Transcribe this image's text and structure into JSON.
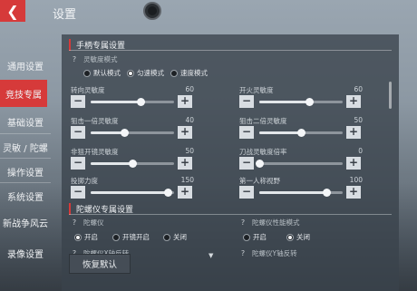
{
  "header": {
    "title": "设置",
    "back_icon": "chevron-left-icon"
  },
  "sidebar": {
    "items": [
      {
        "label": "通用设置",
        "active": false
      },
      {
        "label": "竞技专属",
        "active": true
      },
      {
        "label": "基础设置",
        "active": false
      },
      {
        "label": "灵敏 / 陀螺",
        "active": false
      },
      {
        "label": "操作设置",
        "active": false
      },
      {
        "label": "系统设置",
        "active": false
      },
      {
        "label": "新战争风云",
        "active": false
      },
      {
        "label": "录像设置",
        "active": false
      }
    ]
  },
  "section1": {
    "title": "手柄专属设置",
    "mode": {
      "label": "灵敏度模式",
      "options": [
        "默认模式",
        "匀速模式",
        "速度模式"
      ],
      "selected": 1
    },
    "sliders": [
      {
        "label": "转向灵敏度",
        "value": "60",
        "fraction": 0.6
      },
      {
        "label": "开火灵敏度",
        "value": "60",
        "fraction": 0.6
      },
      {
        "label": "狙击一倍灵敏度",
        "value": "40",
        "fraction": 0.4
      },
      {
        "label": "狙击二倍灵敏度",
        "value": "50",
        "fraction": 0.5
      },
      {
        "label": "非狙开镜灵敏度",
        "value": "50",
        "fraction": 0.5
      },
      {
        "label": "刀战灵敏度倍率",
        "value": "0",
        "fraction": 0.0
      },
      {
        "label": "投掷力度",
        "value": "150",
        "fraction": 0.92
      },
      {
        "label": "第一人称视野",
        "value": "100",
        "fraction": 0.8
      }
    ]
  },
  "section2": {
    "title": "陀螺仪专属设置",
    "gyro": {
      "label": "陀螺仪",
      "options": [
        "开启",
        "开镜开启",
        "关闭"
      ],
      "selected": 0
    },
    "gyro_perf": {
      "label": "陀螺仪性能模式",
      "options": [
        "开启",
        "关闭"
      ],
      "selected": 1
    },
    "x_reverse": {
      "label": "陀螺仪X轴反转"
    },
    "y_reverse": {
      "label": "陀螺仪Y轴反转"
    }
  },
  "footer": {
    "reset_label": "恢复默认"
  },
  "colors": {
    "accent": "#d63a3a",
    "panel": "#3a424b"
  }
}
